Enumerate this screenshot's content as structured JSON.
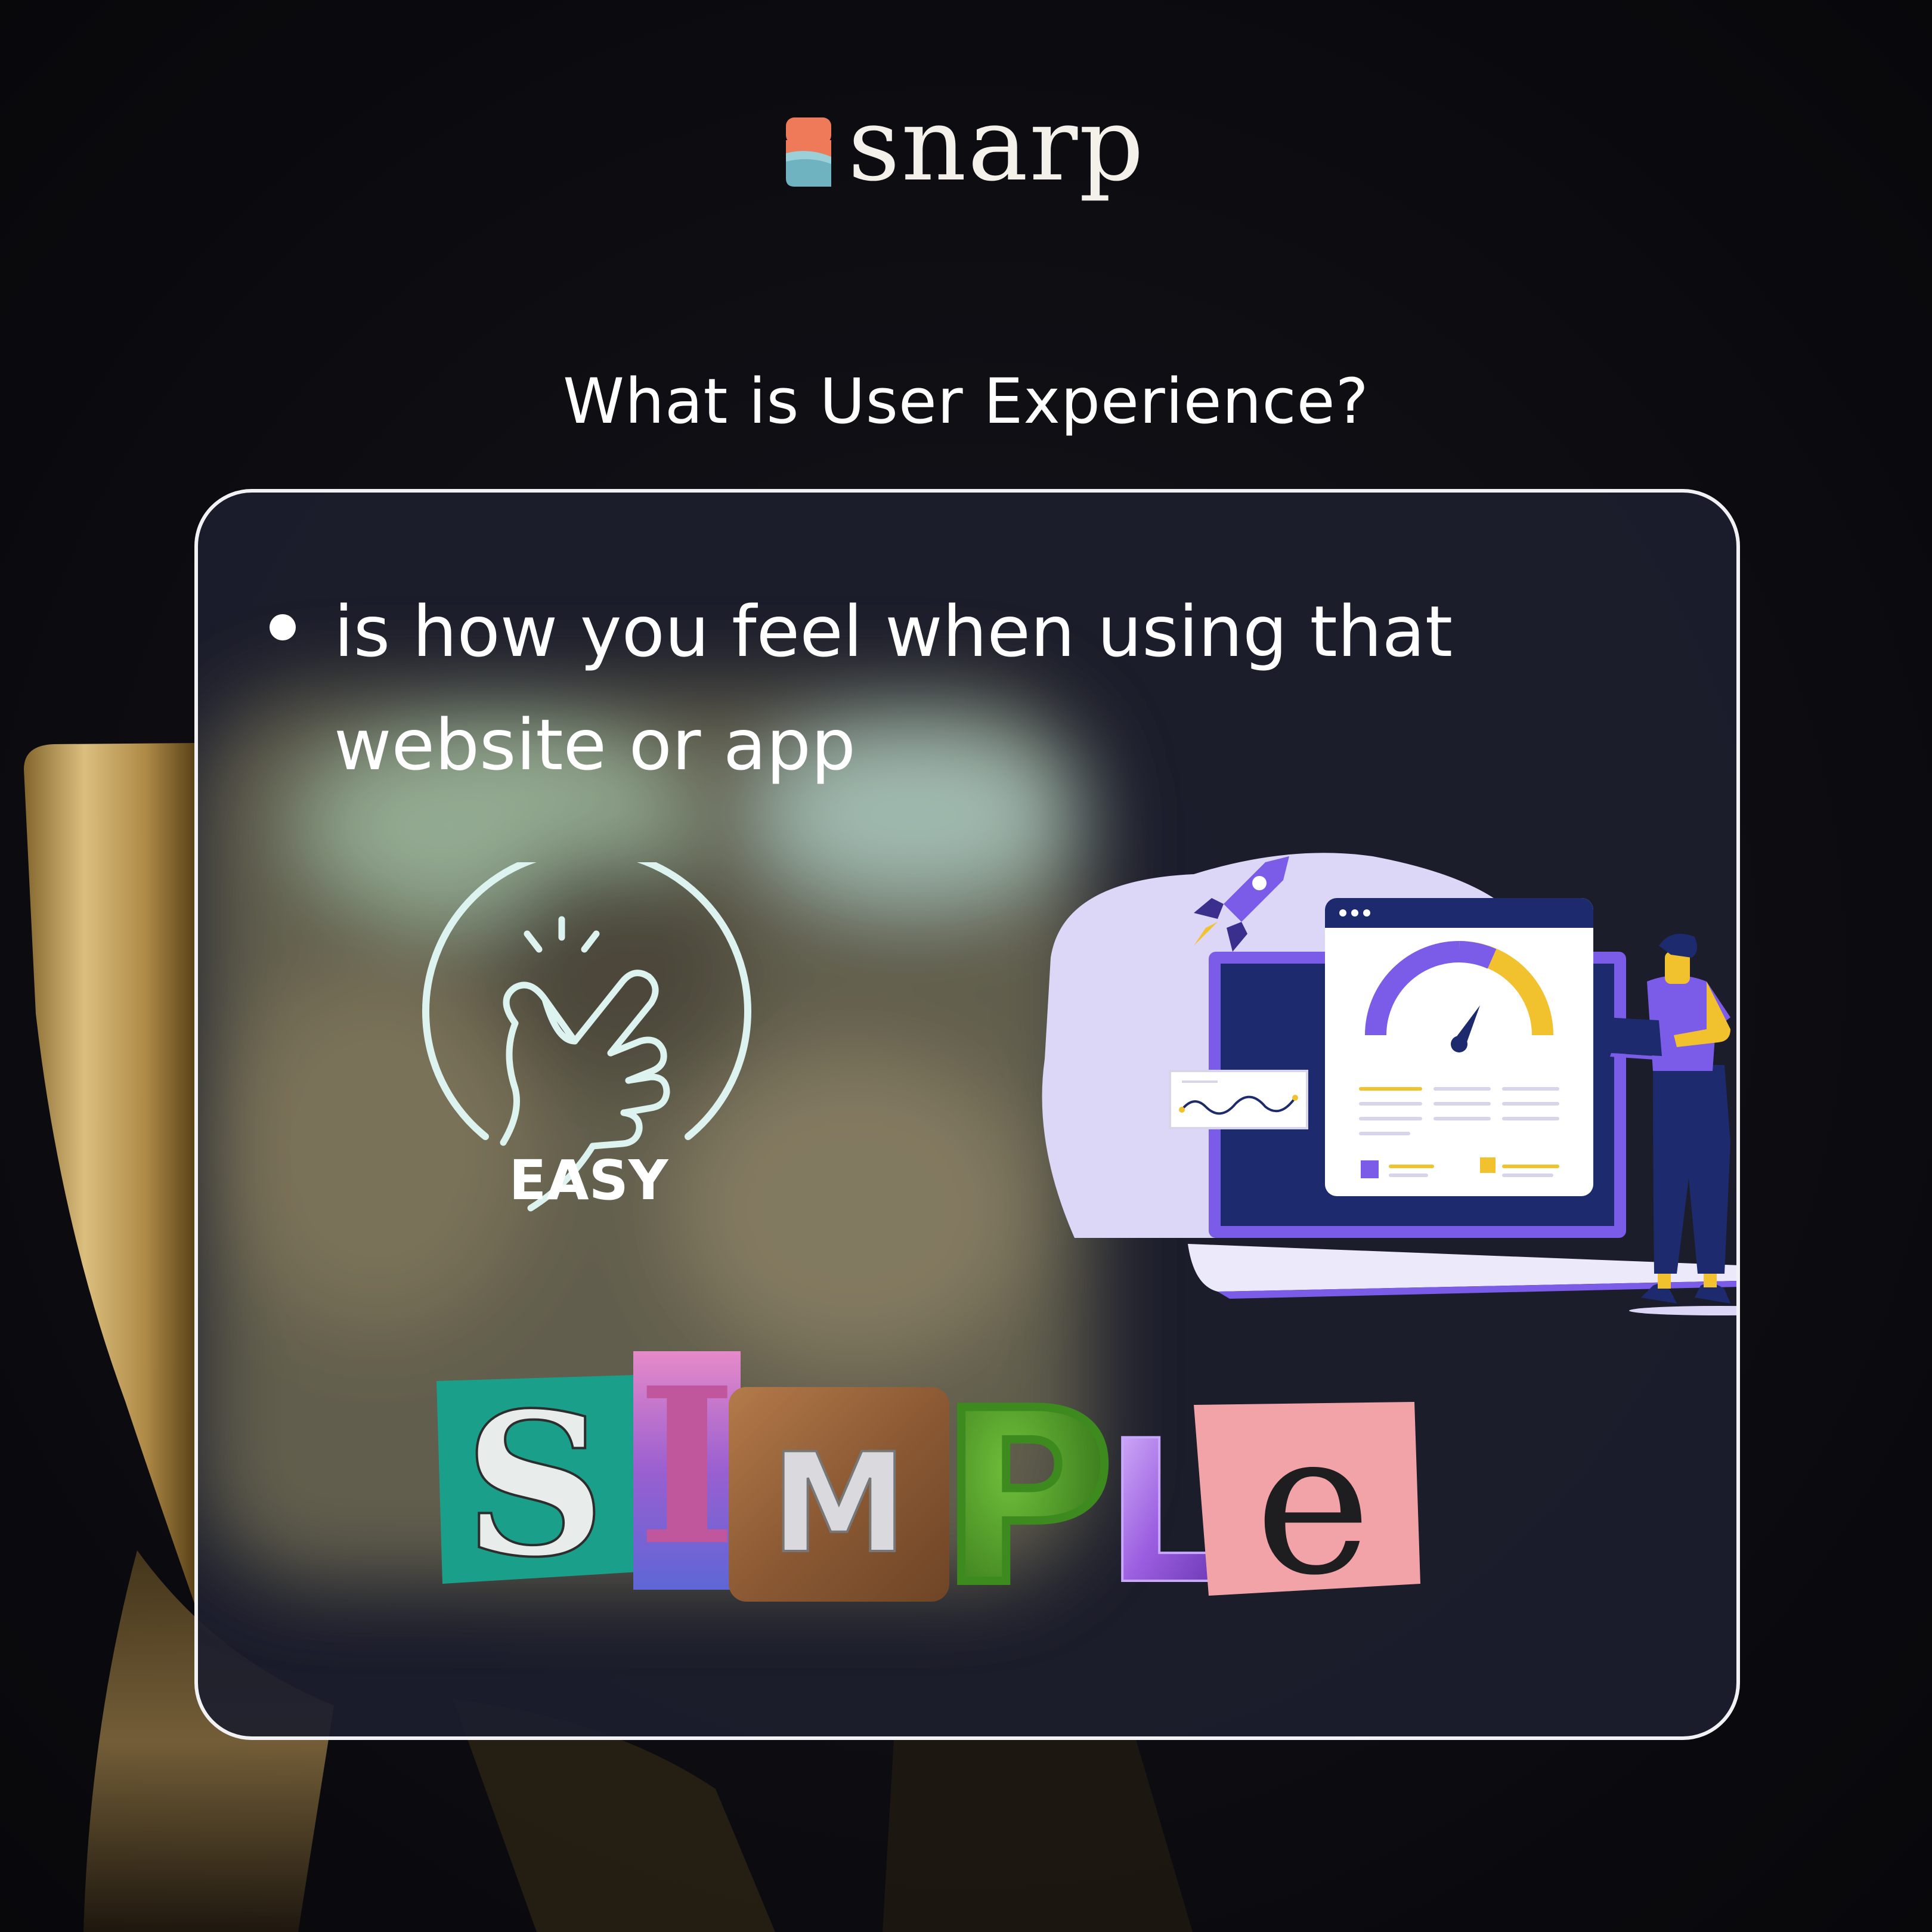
{
  "brand": {
    "name": "snarp",
    "mark_colors": {
      "top": "#ef7a5a",
      "bottom": "#6fb3c1"
    }
  },
  "headline": "What is User Experience?",
  "card": {
    "bullet_text": "is how you feel when using that website or app"
  },
  "easy_badge": {
    "icon": "snap-fingers-icon",
    "label": "EASY",
    "color": "#ddf3ef"
  },
  "illustration": {
    "name": "dashboard-performance-illustration",
    "accent_colors": [
      "#7b5ce8",
      "#f2c12e",
      "#1e2a6e"
    ]
  },
  "word_art": {
    "letters": [
      {
        "char": "S",
        "style": "teal paper cutout"
      },
      {
        "char": "I",
        "style": "pink glitter"
      },
      {
        "char": "M",
        "style": "wood block"
      },
      {
        "char": "P",
        "style": "green fur"
      },
      {
        "char": "L",
        "style": "purple balloon"
      },
      {
        "char": "e",
        "style": "pink paper cutout"
      }
    ]
  }
}
